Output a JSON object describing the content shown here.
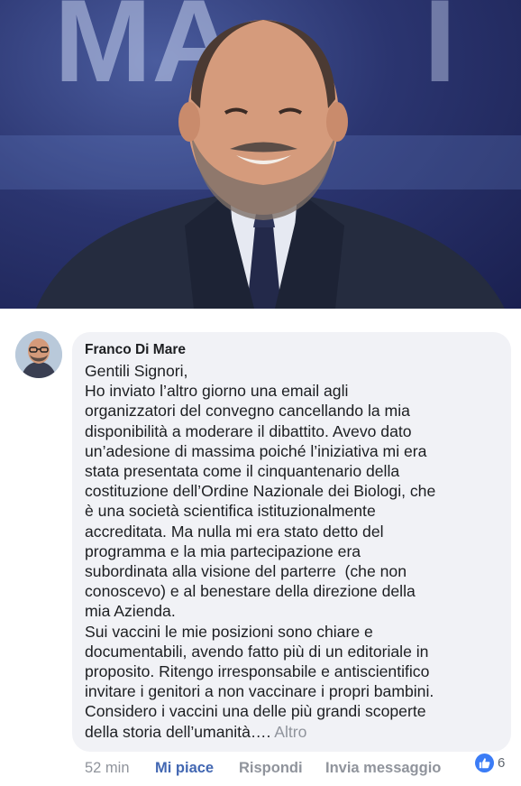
{
  "comment": {
    "author": "Franco Di Mare",
    "lines": [
      "Gentili Signori,",
      "Ho inviato l’altro giorno una email agli",
      "organizzatori del convegno cancellando la mia",
      "disponibilità a moderare il dibattito. Avevo dato",
      "un’adesione di massima poiché l’iniziativa mi era",
      "stata presentata come il cinquantenario della",
      "costituzione dell’Ordine Nazionale dei Biologi, che",
      "è una società scientifica istituzionalmente",
      "accreditata. Ma nulla mi era stato detto del",
      "programma e la mia partecipazione era",
      "subordinata alla visione del parterre  (che non",
      "conoscevo) e al benestare della direzione della",
      "mia Azienda.",
      "Sui vaccini le mie posizioni sono chiare e",
      "documentabili, avendo fatto più di un editoriale in",
      "proposito. Ritengo irresponsabile e antiscientifico",
      "invitare i genitori a non vaccinare i propri bambini.",
      "Considero i vaccini una delle più grandi scoperte",
      "della storia dell’umanità…."
    ],
    "more_label": "Altro",
    "time": "52 min",
    "actions": {
      "like": "Mi piace",
      "reply": "Rispondi",
      "message": "Invia messaggio"
    },
    "reactions": {
      "icon": "thumbs-up-icon",
      "count": "6"
    }
  },
  "colors": {
    "bubble": "#f1f2f6",
    "link_blue": "#4267b2",
    "meta_gray": "#90949c",
    "like_badge": "#3b7cf6"
  }
}
